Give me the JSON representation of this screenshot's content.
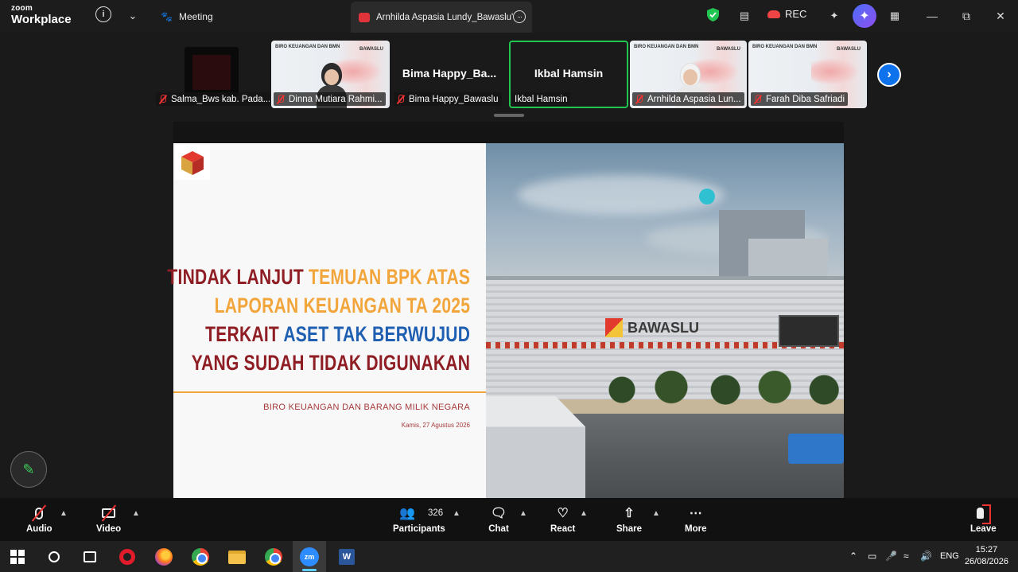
{
  "app": {
    "brand_line1": "zoom",
    "brand_line2": "Workplace"
  },
  "titlebar": {
    "meeting_label": "Meeting",
    "share_tab_label": "Arnhilda Aspasia Lundy_Bawaslu'",
    "rec_label": "REC"
  },
  "gallery": {
    "tiles": [
      {
        "name": "Salma_Bws kab. Pada..."
      },
      {
        "name": "Dinna Mutiara Rahmi..."
      },
      {
        "name": "Bima Happy_Bawaslu",
        "display_name": "Bima  Happy_Ba..."
      },
      {
        "name": "Ikbal Hamsin",
        "display_name": "Ikbal Hamsin"
      },
      {
        "name": "Arnhilda Aspasia Lun..."
      },
      {
        "name": "Farah Diba Safriadi"
      }
    ],
    "video_label": "BIRO KEUANGAN DAN BMN",
    "video_logo": "BAWASLU"
  },
  "slide": {
    "title_line1_a": "TINDAK LANJUT ",
    "title_line1_b": "TEMUAN BPK ATAS",
    "title_line2": "LAPORAN KEUANGAN TA 2025",
    "title_line3_a": "TERKAIT ",
    "title_line3_b": "ASET TAK BERWUJUD",
    "title_line4": "YANG SUDAH TIDAK DIGUNAKAN",
    "subtitle": "BIRO KEUANGAN DAN BARANG MILIK NEGARA",
    "date": "Kamis, 27 Agustus 2026",
    "building_sign": "BAWASLU"
  },
  "toolbar": {
    "audio": "Audio",
    "video": "Video",
    "participants": "Participants",
    "participants_count": "326",
    "chat": "Chat",
    "react": "React",
    "share": "Share",
    "more": "More",
    "leave": "Leave"
  },
  "taskbar": {
    "zoom_label": "zm",
    "word_label": "W",
    "language": "ENG",
    "time": "15:27",
    "date": "26/08/2026"
  },
  "colors": {
    "zoom_blue": "#0e72ed",
    "active_speaker_green": "#23c552",
    "mute_red": "#e33333",
    "slide_dark_red": "#8e1d24",
    "slide_orange": "#f2a53a",
    "slide_blue": "#1f5fb2"
  }
}
